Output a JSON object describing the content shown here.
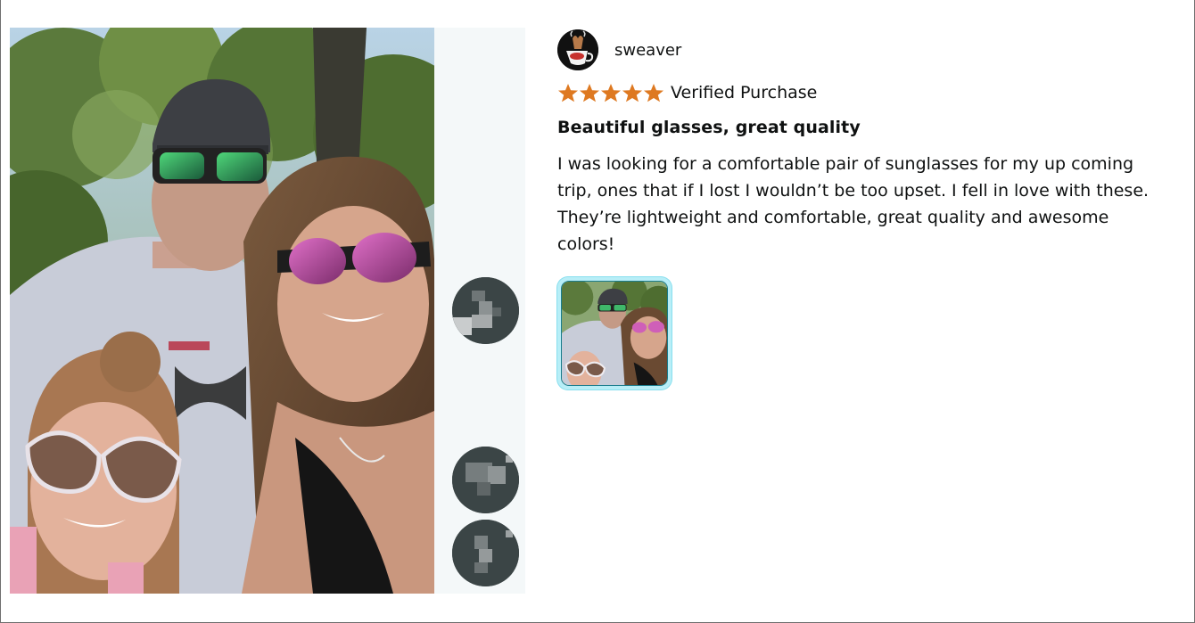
{
  "reviewer": {
    "name": "sweaver",
    "avatar_icon": "coffee-cup-avatar-icon"
  },
  "rating": {
    "stars": 5,
    "out_of": 5,
    "star_color": "#de7921"
  },
  "verified_label": "Verified Purchase",
  "review": {
    "title": "Beautiful glasses, great quality",
    "body": "I was looking for a comfortable pair of sunglasses for my up coming trip, ones that if I lost I wouldn’t be too upset. I fell in love with these. They’re lightweight and comfortable, great quality and awesome colors!"
  },
  "media": {
    "main_image_icon": "review-photo",
    "thumbnail_selected_color": "#b8eef7",
    "rail_thumbnails": [
      {
        "icon": "blurred-avatar-icon"
      },
      {
        "icon": "blurred-avatar-icon"
      },
      {
        "icon": "blurred-avatar-icon"
      }
    ]
  }
}
